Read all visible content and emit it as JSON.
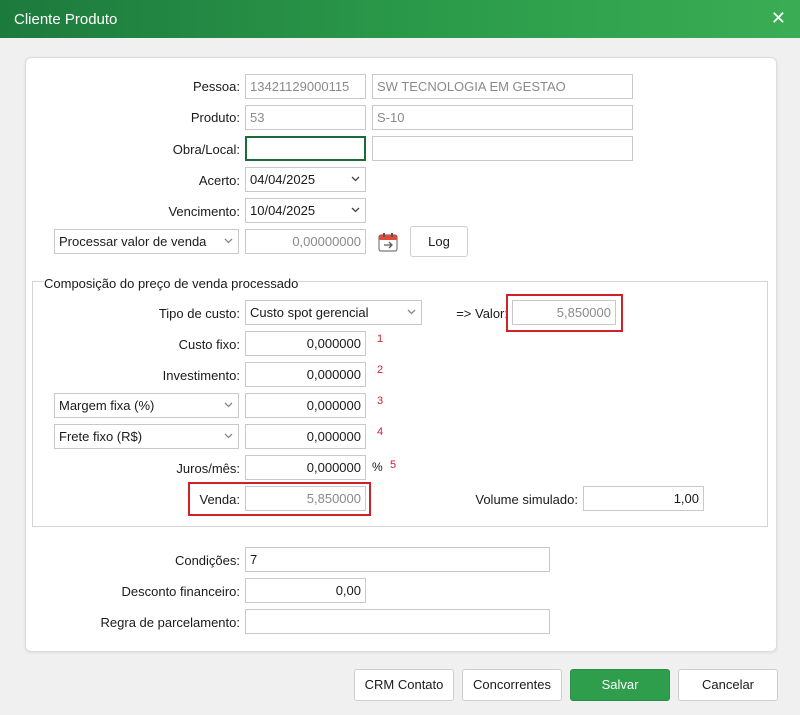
{
  "window": {
    "title": "Cliente Produto",
    "close_glyph": "✕"
  },
  "form": {
    "pessoa": {
      "label": "Pessoa:",
      "code": "13421129000115",
      "name": "SW TECNOLOGIA EM GESTAO"
    },
    "produto": {
      "label": "Produto:",
      "code": "53",
      "name": "S-10"
    },
    "obra": {
      "label": "Obra/Local:",
      "code": "",
      "name": ""
    },
    "acerto": {
      "label": "Acerto:",
      "value": "04/04/2025"
    },
    "vencimento": {
      "label": "Vencimento:",
      "value": "10/04/2025"
    },
    "processar": {
      "selected": "Processar valor de venda",
      "value": "0,00000000"
    },
    "log_label": "Log"
  },
  "composicao": {
    "title": "Composição do preço de venda processado",
    "tipo_custo": {
      "label": "Tipo de custo:",
      "selected": "Custo spot gerencial"
    },
    "valor": {
      "label": "=> Valor:",
      "value": "5,850000"
    },
    "custo_fixo": {
      "label": "Custo fixo:",
      "value": "0,000000",
      "marker": "1"
    },
    "investimento": {
      "label": "Investimento:",
      "value": "0,000000",
      "marker": "2"
    },
    "margem": {
      "selected": "Margem fixa (%)",
      "value": "0,000000",
      "marker": "3"
    },
    "frete": {
      "selected": "Frete fixo (R$)",
      "value": "0,000000",
      "marker": "4"
    },
    "juros": {
      "label": "Juros/mês:",
      "value": "0,000000",
      "unit": "%",
      "marker": "5"
    },
    "venda": {
      "label": "Venda:",
      "value": "5,850000"
    },
    "volume": {
      "label": "Volume simulado:",
      "value": "1,00"
    }
  },
  "rodape": {
    "condicoes": {
      "label": "Condições:",
      "value": "7"
    },
    "desconto": {
      "label": "Desconto financeiro:",
      "value": "0,00"
    },
    "regra": {
      "label": "Regra de parcelamento:",
      "value": ""
    }
  },
  "buttons": {
    "crm": "CRM Contato",
    "concorrentes": "Concorrentes",
    "salvar": "Salvar",
    "cancelar": "Cancelar"
  },
  "colors": {
    "accent": "#2e9e4c",
    "highlight": "#d0202a"
  }
}
